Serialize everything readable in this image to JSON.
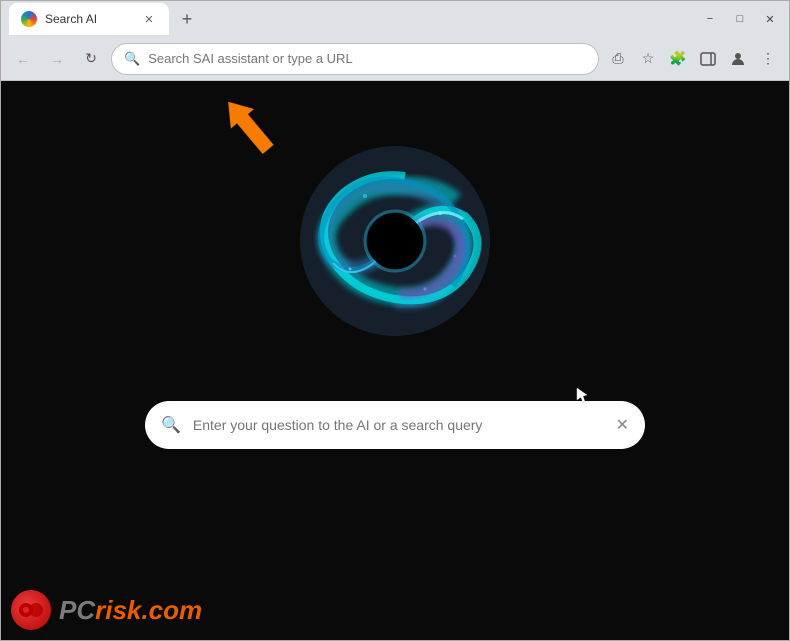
{
  "browser": {
    "tab": {
      "title": "Search AI",
      "favicon_alt": "Search AI favicon"
    },
    "new_tab_label": "+",
    "window_controls": {
      "minimize": "−",
      "maximize": "□",
      "close": "✕"
    },
    "nav": {
      "back_label": "←",
      "forward_label": "→",
      "refresh_label": "↻",
      "address_placeholder": "Search SAI assistant or type a URL"
    },
    "toolbar_icons": {
      "share": "⎙",
      "bookmark": "☆",
      "extension": "🧩",
      "sidebar": "▭",
      "profile": "👤",
      "menu": "⋮"
    }
  },
  "page": {
    "background_color": "#0a0a0a",
    "search_placeholder": "Enter your question to the AI or a search query",
    "search_clear": "✕",
    "watermark": {
      "text_gray": "PC",
      "text_orange": "risk.com"
    }
  },
  "arrow": {
    "color": "#f57c00",
    "direction": "up"
  }
}
